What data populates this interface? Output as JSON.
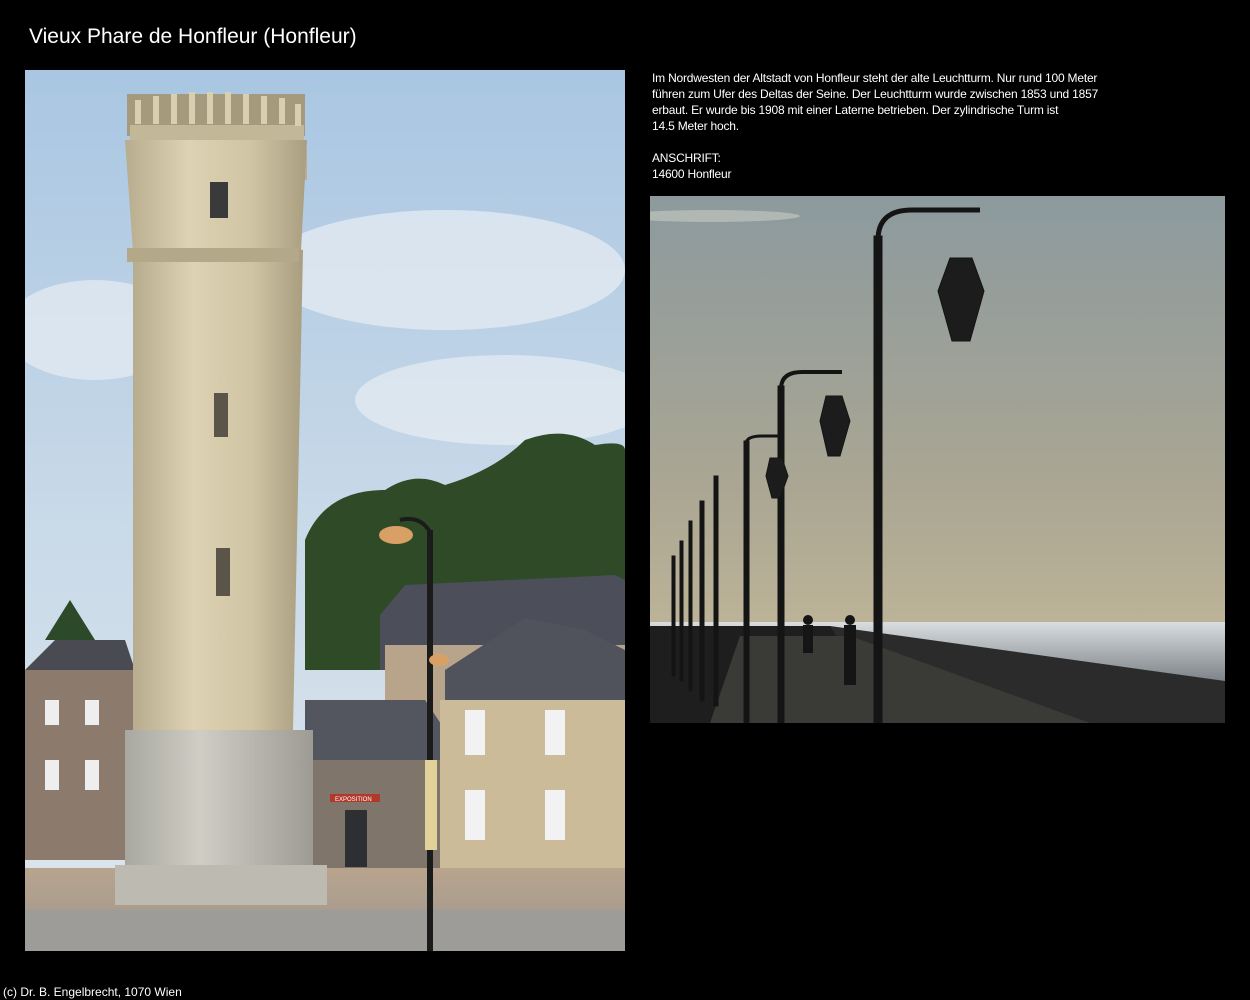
{
  "page": {
    "title": "Vieux Phare de Honfleur (Honfleur)"
  },
  "description": {
    "lines": [
      "Im Nordwesten der Altstadt von Honfleur steht der alte Leuchtturm. Nur rund 100 Meter",
      "führen zum Ufer des Deltas der Seine. Der Leuchtturm wurde zwischen 1853 und 1857",
      "erbaut. Er wurde bis 1908 mit einer Laterne betrieben. Der zylindrische Turm ist",
      "14.5 Meter hoch."
    ],
    "address_label": "ANSCHRIFT:",
    "address_value": "14600 Honfleur"
  },
  "images": {
    "lighthouse": "lighthouse-photo",
    "promenade": "promenade-photo",
    "sign_text": "EXPOSITION"
  },
  "footer": {
    "copyright": "(c) Dr. B. Engelbrecht, 1070 Wien"
  },
  "colors": {
    "background": "#000000",
    "text": "#ffffff",
    "sky": "#b9cfe2",
    "stone": "#cdc2a0"
  }
}
